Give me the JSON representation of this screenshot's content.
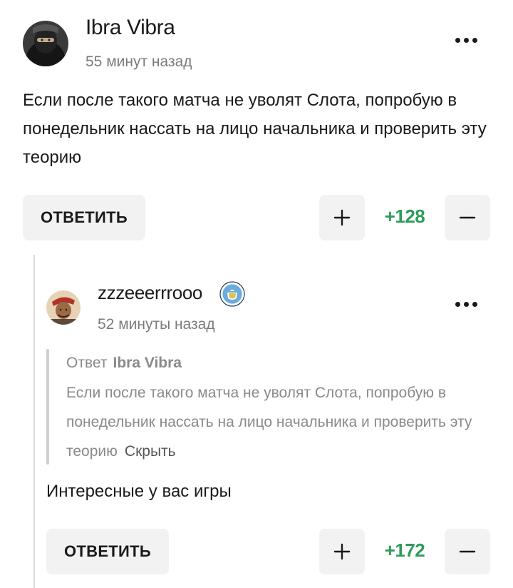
{
  "comment": {
    "author": "Ibra Vibra",
    "time": "55 минут назад",
    "text": "Если после такого матча не уволят Слота, попробую в понедельник нассать на лицо начальника и проверить эту теорию",
    "reply_label": "ОТВЕТИТЬ",
    "score": "+128"
  },
  "reply": {
    "author": "zzzeeerrrooo",
    "badge_icon": "manchester-city-badge-icon",
    "time": "52 минуты назад",
    "quote": {
      "prefix": "Ответ",
      "author": "Ibra Vibra",
      "text": "Если после такого матча не уволят Слота, попробую в понедельник нассать на лицо начальника и проверить эту теорию",
      "hide_label": "Скрыть"
    },
    "text": "Интересные у вас игры",
    "reply_label": "ОТВЕТИТЬ",
    "score": "+172"
  },
  "colors": {
    "score_green": "#2e9c5b",
    "button_bg": "#f2f2f2",
    "muted_text": "#7b7b7b",
    "badge_blue": "#6cabdd"
  }
}
